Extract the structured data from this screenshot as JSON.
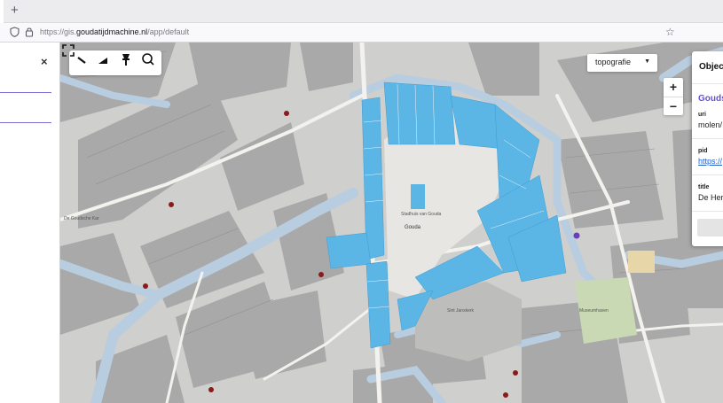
{
  "browser": {
    "new_tab_label": "+",
    "url_prefix": "https://gis.",
    "url_domain": "goudatijdmachine.nl",
    "url_path": "/app/default",
    "icons": [
      "shield-icon",
      "lock-icon",
      "bookmark-star-icon"
    ]
  },
  "sidepanel": {
    "close_label": "×"
  },
  "map": {
    "layer_select": {
      "value": "topografie"
    },
    "zoom_in_label": "+",
    "zoom_out_label": "−",
    "tools": [
      "measure-line-icon",
      "measure-area-icon",
      "pin-icon",
      "search-icon"
    ],
    "labels": {
      "gouda": "Gouda",
      "sint_janskerk": "Sint Janskerk",
      "de_goudsche_kar": "De Goudsche Kar",
      "stadhuis": "Stadhuis van Gouda",
      "museum": "Museumhaven"
    },
    "colors": {
      "highlight": "#5bb6e6",
      "water": "#b9cde0",
      "building": "#a7a7a7",
      "road": "#f4f2ee",
      "park": "#c9d9b4"
    }
  },
  "object_panel": {
    "title": "Object",
    "heading": "Goudsche",
    "fields": [
      {
        "label": "uri",
        "value": "molen/"
      },
      {
        "label": "pid",
        "value": "https://"
      },
      {
        "label": "title",
        "value": "De Her"
      }
    ]
  }
}
